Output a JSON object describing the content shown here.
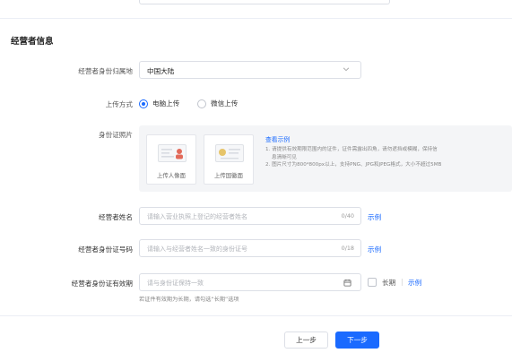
{
  "section": {
    "title": "经营者信息"
  },
  "id_region": {
    "label": "经营者身份归属地",
    "value": "中国大陆"
  },
  "upload_method": {
    "label": "上传方式",
    "options": [
      "电脑上传",
      "微信上传"
    ],
    "selected": "电脑上传"
  },
  "id_photo": {
    "label": "身份证照片",
    "front_caption": "上传人像面",
    "back_caption": "上传国徽面",
    "example_link": "查看示例",
    "tips": [
      "1. 请提供有效期限范围内的证件，证件需露出四角，请勿遮挡或模糊，保持信",
      "息清晰可见",
      "2. 图片尺寸为800*800px以上，支持PNG、JPG和JPEG格式，大小不超过5MB"
    ]
  },
  "operator_name": {
    "label": "经营者姓名",
    "placeholder": "请输入营业执照上登记的经营者姓名",
    "counter": "0/40",
    "example": "示例"
  },
  "id_number": {
    "label": "经营者身份证号码",
    "placeholder": "请输入与经营者姓名一致的身份证号",
    "counter": "0/18",
    "example": "示例"
  },
  "id_validity": {
    "label": "经营者身份证有效期",
    "placeholder": "请与身份证保持一致",
    "long_term_label": "长期",
    "separator": "|",
    "example": "示例",
    "hint": "若证件有效期为长期，请勾选“长期”选项"
  },
  "footer": {
    "prev": "上一步",
    "next": "下一步"
  },
  "colors": {
    "accent": "#1a6aff",
    "border": "#dcdfe6",
    "panel": "#f4f5f7"
  }
}
